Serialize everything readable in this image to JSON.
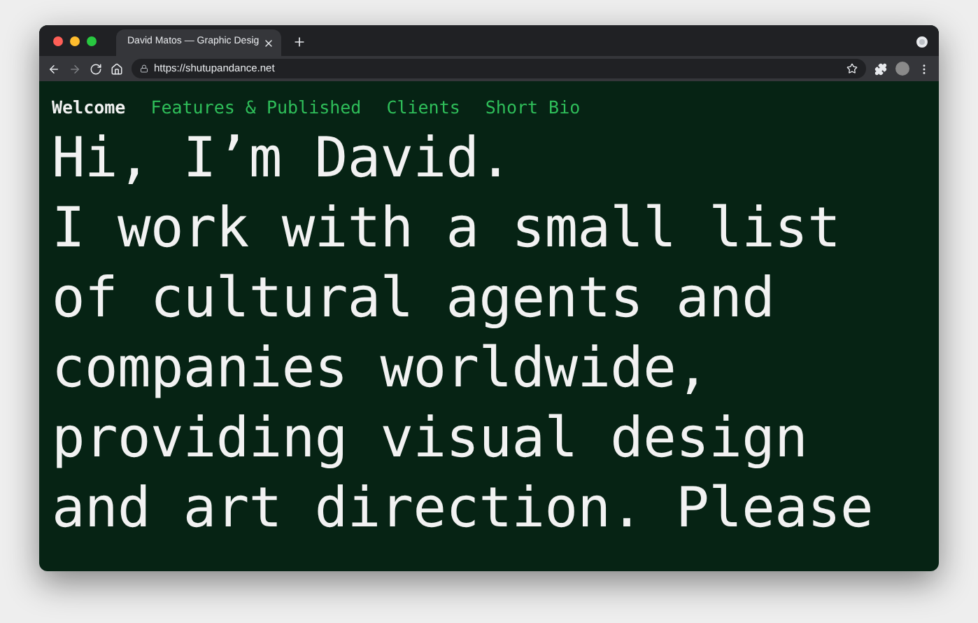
{
  "browser": {
    "tabs": [
      {
        "title": "David Matos — Graphic Desig",
        "selected": true
      }
    ],
    "url": "https://shutupandance.net"
  },
  "nav": [
    {
      "label": "Welcome",
      "selected": true
    },
    {
      "label": "Features & Published",
      "selected": false
    },
    {
      "label": "Clients",
      "selected": false
    },
    {
      "label": "Short Bio",
      "selected": false
    }
  ],
  "intro": [
    "Hi, I’m David.",
    "I work with a small list",
    "of cultural agents and",
    "companies worldwide,",
    "providing visual design",
    "and art direction. Please"
  ]
}
